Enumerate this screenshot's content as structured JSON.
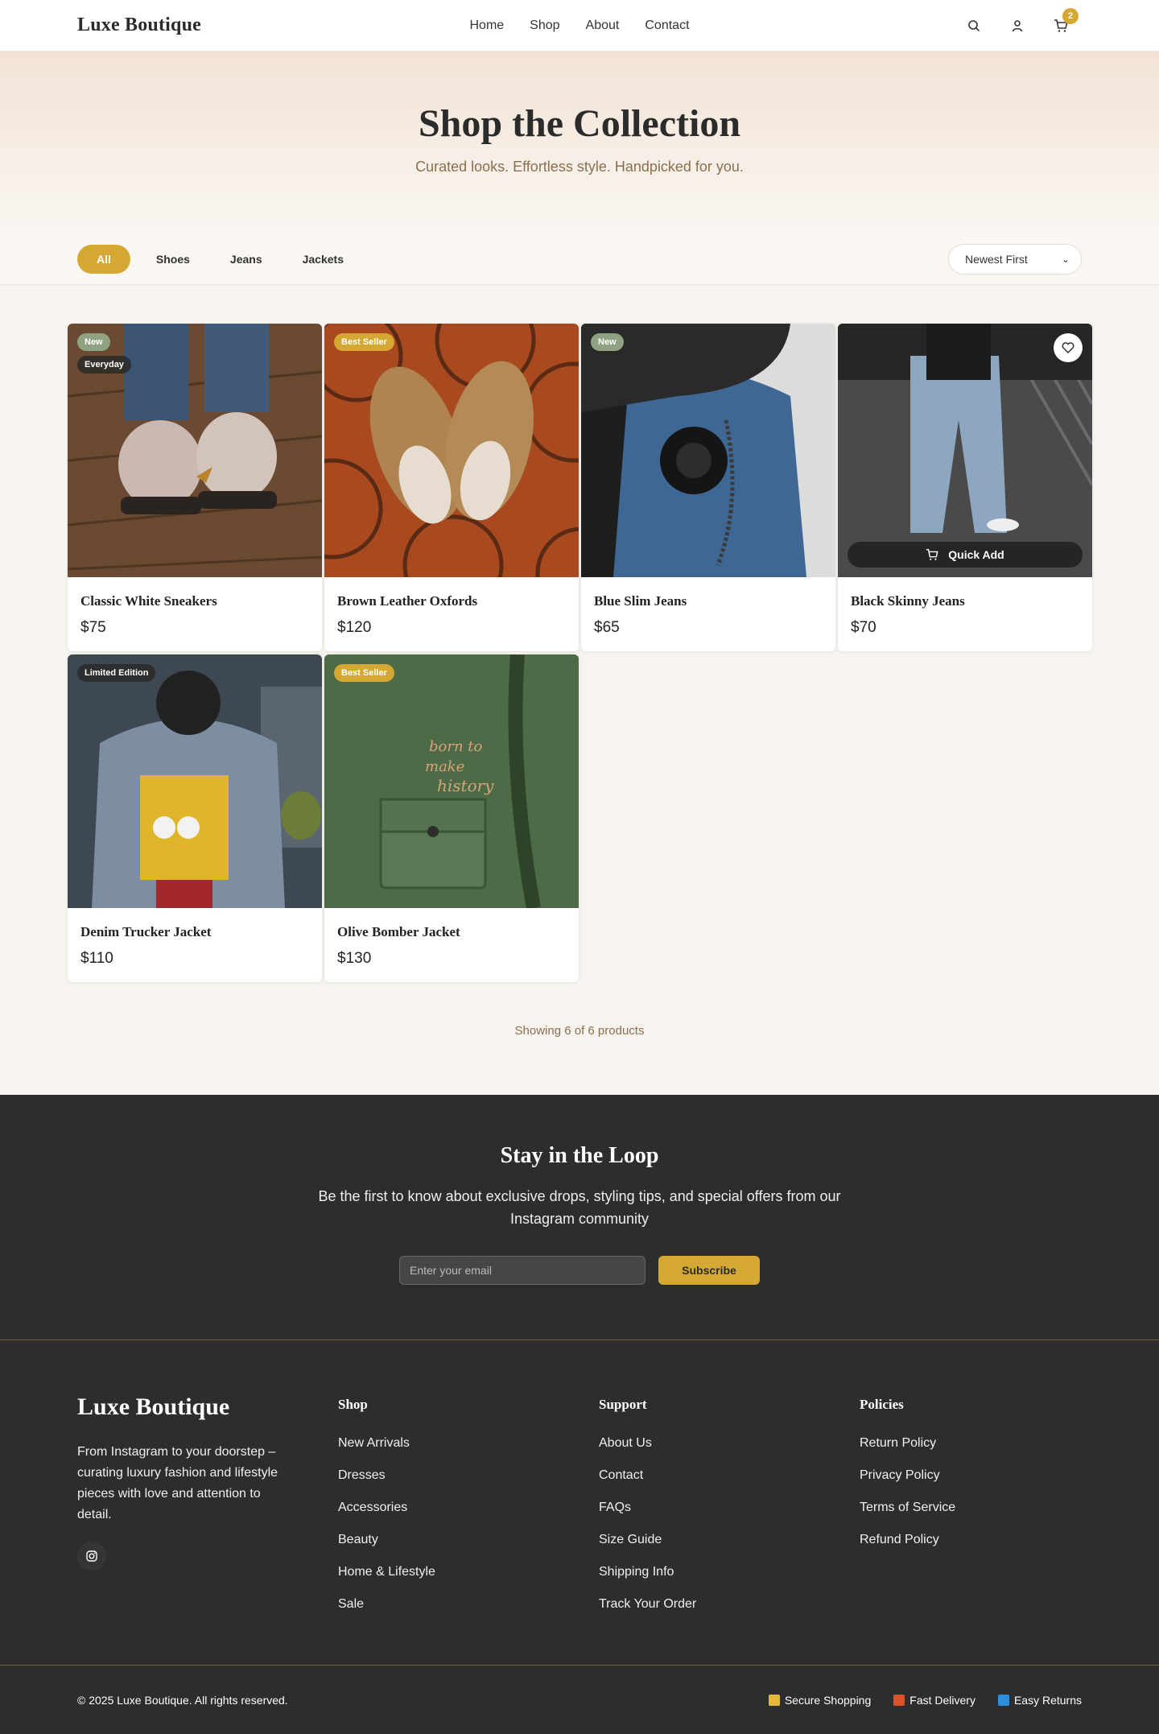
{
  "brand": "Luxe Boutique",
  "nav": [
    "Home",
    "Shop",
    "About",
    "Contact"
  ],
  "cart_count": "2",
  "hero": {
    "title": "Shop the Collection",
    "subtitle": "Curated looks. Effortless style. Handpicked for you."
  },
  "filters": [
    "All",
    "Shoes",
    "Jeans",
    "Jackets"
  ],
  "active_filter": "All",
  "sort": "Newest First",
  "products": [
    {
      "name": "Classic White Sneakers",
      "price": "$75",
      "tags": [
        "New",
        "Everyday"
      ]
    },
    {
      "name": "Brown Leather Oxfords",
      "price": "$120",
      "tags": [
        "Best Seller"
      ]
    },
    {
      "name": "Blue Slim Jeans",
      "price": "$65",
      "tags": [
        "New"
      ]
    },
    {
      "name": "Black Skinny Jeans",
      "price": "$70",
      "tags": [],
      "quick_add": "Quick Add"
    },
    {
      "name": "Denim Trucker Jacket",
      "price": "$110",
      "tags": [
        "Limited Edition"
      ]
    },
    {
      "name": "Olive Bomber Jacket",
      "price": "$130",
      "tags": [
        "Best Seller"
      ]
    }
  ],
  "showing": "Showing 6 of 6 products",
  "newsletter": {
    "title": "Stay in the Loop",
    "text": "Be the first to know about exclusive drops, styling tips, and special offers from our Instagram community",
    "placeholder": "Enter your email",
    "button": "Subscribe"
  },
  "footer": {
    "logo": "Luxe Boutique",
    "description": "From Instagram to your doorstep – curating luxury fashion and lifestyle pieces with love and attention to detail.",
    "columns": [
      {
        "title": "Shop",
        "links": [
          "New Arrivals",
          "Dresses",
          "Accessories",
          "Beauty",
          "Home & Lifestyle",
          "Sale"
        ]
      },
      {
        "title": "Support",
        "links": [
          "About Us",
          "Contact",
          "FAQs",
          "Size Guide",
          "Shipping Info",
          "Track Your Order"
        ]
      },
      {
        "title": "Policies",
        "links": [
          "Return Policy",
          "Privacy Policy",
          "Terms of Service",
          "Refund Policy"
        ]
      }
    ],
    "copyright": "© 2025 Luxe Boutique. All rights reserved.",
    "trust": [
      "Secure Shopping",
      "Fast Delivery",
      "Easy Returns"
    ]
  },
  "colors": {
    "accent": "#d4a832",
    "dark": "#2d2d2d",
    "tag_new": "#8fa382"
  }
}
